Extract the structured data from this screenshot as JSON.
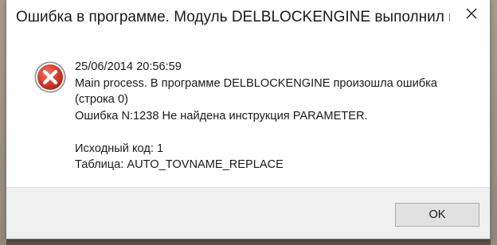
{
  "window": {
    "title": "Ошибка в программе. Модуль DELBLOCKENGINE выполнил недоп..."
  },
  "message": {
    "timestamp": "25/06/2014 20:56:59",
    "line1": "Main process. В программе DELBLOCKENGINE произошла ошибка",
    "line2": "(строка 0)",
    "line3": "Ошибка N:1238 Не найдена инструкция PARAMETER.",
    "line4": "Исходный код: 1",
    "line5": "Таблица: AUTO_TOVNAME_REPLACE"
  },
  "buttons": {
    "ok_label": "OK"
  },
  "icons": {
    "error": "error-icon",
    "close": "close-icon"
  },
  "colors": {
    "error_red": "#c9342b",
    "footer_bg": "#f0f0f0",
    "button_bg": "#e1e1e1"
  }
}
